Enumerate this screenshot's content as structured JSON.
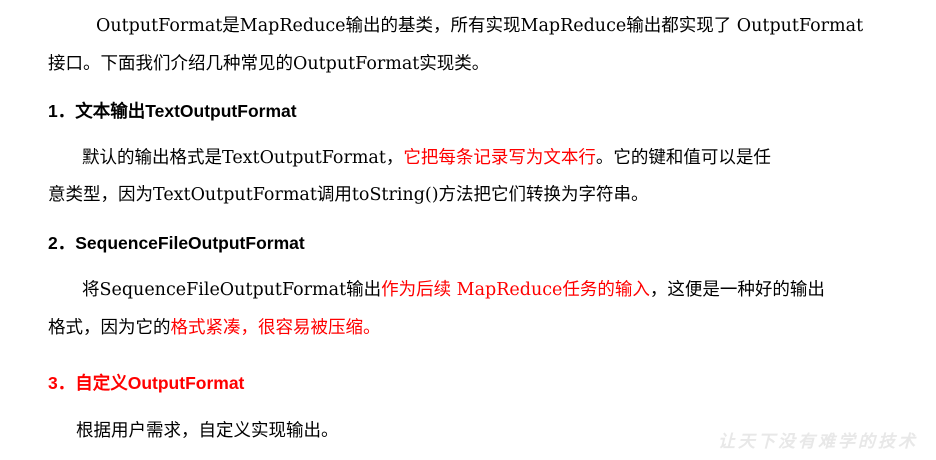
{
  "intro": {
    "line1": "OutputFormat是MapReduce输出的基类，所有实现MapReduce输出都实现了 OutputFormat",
    "line2": "接口。下面我们介绍几种常见的OutputFormat实现类。"
  },
  "section1": {
    "heading": "1．文本输出TextOutputFormat",
    "p_line1_a": "默认的输出格式是TextOutputFormat，",
    "p_line1_red": "它把每条记录写为文本行",
    "p_line1_b": "。它的键和值可以是任",
    "p_line2": "意类型，因为TextOutputFormat调用toString()方法把它们转换为字符串。"
  },
  "section2": {
    "heading": "2．SequenceFileOutputFormat",
    "p_line1_a": "将SequenceFileOutputFormat输出",
    "p_line1_red": "作为后续 MapReduce任务的输入",
    "p_line1_b": "，这便是一种好的输出",
    "p_line2_a": "格式，因为它的",
    "p_line2_red": "格式紧凑，很容易被压缩。"
  },
  "section3": {
    "heading": "3．自定义OutputFormat",
    "p_line1": "根据用户需求，自定义实现输出。"
  },
  "watermark": "让天下没有难学的技术",
  "colors": {
    "text": "#000000",
    "highlight": "#ff0000",
    "watermark": "#e8e8e8"
  }
}
